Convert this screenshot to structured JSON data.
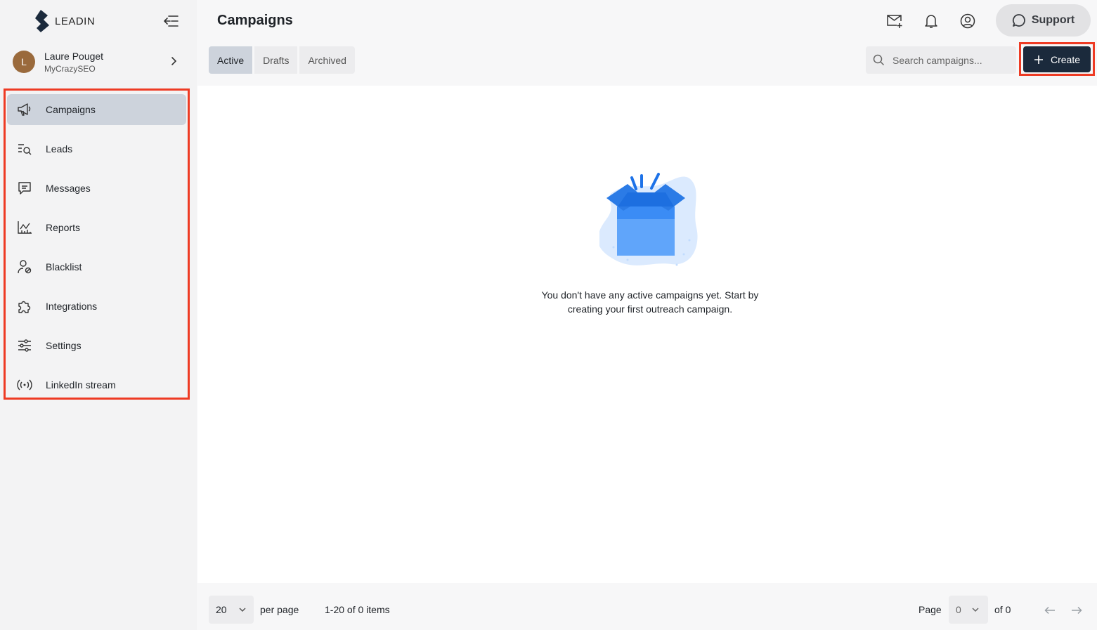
{
  "app": {
    "logo_text": "LEADIN"
  },
  "user": {
    "initial": "L",
    "name": "Laure Pouget",
    "org": "MyCrazySEO"
  },
  "sidebar": {
    "items": [
      {
        "label": "Campaigns",
        "icon": "megaphone-icon",
        "active": true
      },
      {
        "label": "Leads",
        "icon": "list-search-icon"
      },
      {
        "label": "Messages",
        "icon": "chat-icon"
      },
      {
        "label": "Reports",
        "icon": "chart-icon"
      },
      {
        "label": "Blacklist",
        "icon": "user-block-icon"
      },
      {
        "label": "Integrations",
        "icon": "puzzle-icon"
      },
      {
        "label": "Settings",
        "icon": "sliders-icon"
      },
      {
        "label": "LinkedIn stream",
        "icon": "broadcast-icon"
      }
    ]
  },
  "header": {
    "title": "Campaigns",
    "support_label": "Support"
  },
  "tabs": [
    {
      "label": "Active",
      "active": true
    },
    {
      "label": "Drafts"
    },
    {
      "label": "Archived"
    }
  ],
  "search": {
    "placeholder": "Search campaigns...",
    "value": ""
  },
  "create": {
    "label": "Create"
  },
  "empty_state": {
    "message": "You don't have any active campaigns yet. Start by creating your first outreach campaign."
  },
  "pagination": {
    "per_page_value": "20",
    "per_page_label": "per page",
    "items_summary": "1-20 of 0 items",
    "page_label": "Page",
    "page_value": "0",
    "of_label": "of 0"
  },
  "colors": {
    "accent_dark": "#1b2a3c",
    "active_bg": "#cdd3dc",
    "highlight": "#ee3b24",
    "illustration_blue": "#3b8cf5"
  }
}
